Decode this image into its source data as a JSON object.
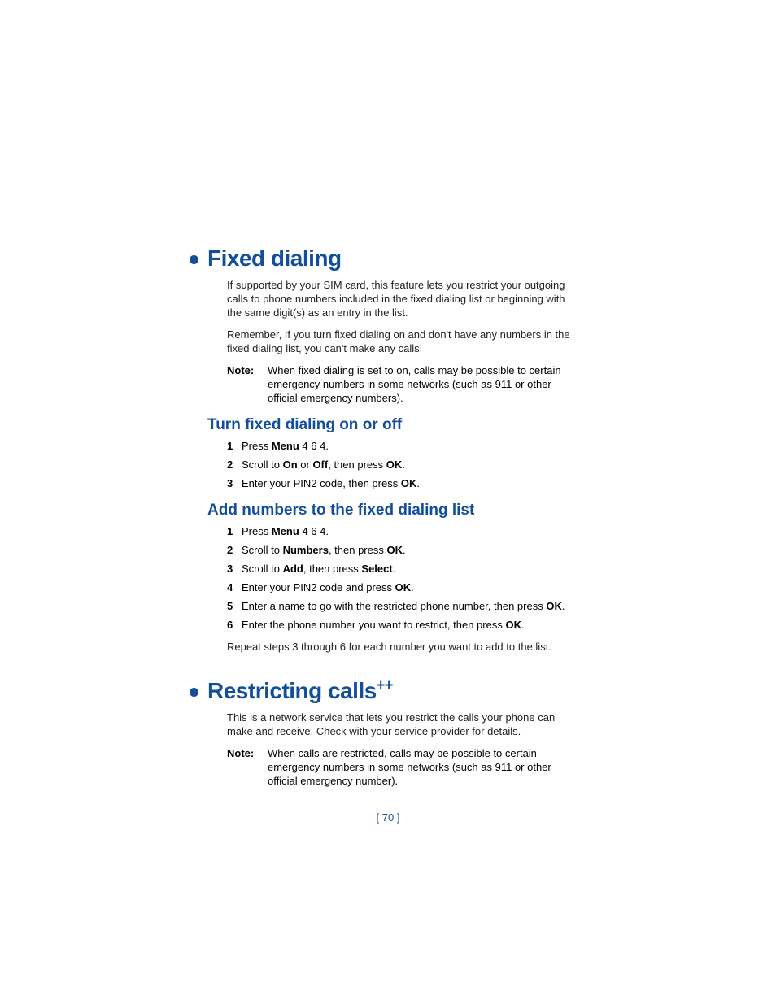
{
  "section1": {
    "title": "Fixed dialing",
    "para1": "If supported by your SIM card, this feature lets you restrict your outgoing calls to phone numbers included in the fixed dialing list or beginning with the same digit(s) as an entry in the list.",
    "para2": "Remember, If you turn fixed dialing on and don't have any numbers in the fixed dialing list, you can't make any calls!",
    "note_label": "Note:",
    "note_text": "When fixed dialing is set to on, calls may be possible to certain emergency numbers in some networks (such as 911 or other official emergency numbers).",
    "sub1": {
      "heading": "Turn fixed dialing on or off",
      "steps": [
        {
          "n": "1",
          "pre": "Press ",
          "b1": "Menu",
          "post": " 4 6 4."
        },
        {
          "n": "2",
          "pre": "Scroll to ",
          "b1": "On",
          "mid": " or ",
          "b2": "Off",
          "mid2": ", then press ",
          "b3": "OK",
          "post": "."
        },
        {
          "n": "3",
          "pre": "Enter your PIN2 code, then press ",
          "b1": "OK",
          "post": "."
        }
      ]
    },
    "sub2": {
      "heading": "Add numbers to the fixed dialing list",
      "steps": [
        {
          "n": "1",
          "pre": "Press ",
          "b1": "Menu",
          "post": " 4 6 4."
        },
        {
          "n": "2",
          "pre": "Scroll to ",
          "b1": "Numbers",
          "mid": ", then press ",
          "b2": "OK",
          "post": "."
        },
        {
          "n": "3",
          "pre": "Scroll to ",
          "b1": "Add",
          "mid": ", then press ",
          "b2": "Select",
          "post": "."
        },
        {
          "n": "4",
          "pre": "Enter your PIN2 code and press ",
          "b1": "OK",
          "post": "."
        },
        {
          "n": "5",
          "pre": "Enter a name to go with the restricted phone number, then press ",
          "b1": "OK",
          "post": "."
        },
        {
          "n": "6",
          "pre": "Enter the phone number you want to restrict, then press ",
          "b1": "OK",
          "post": "."
        }
      ],
      "after": "Repeat steps 3 through 6 for each number you want to add to the list."
    }
  },
  "section2": {
    "title": "Restricting calls",
    "title_sup": "++",
    "para1": "This is a network service that lets you restrict the calls your phone can make and receive. Check with your service provider for details.",
    "note_label": "Note:",
    "note_text": "When calls are restricted, calls may be possible to certain emergency numbers in some networks (such as 911 or other official emergency number)."
  },
  "footer": "[ 70 ]"
}
